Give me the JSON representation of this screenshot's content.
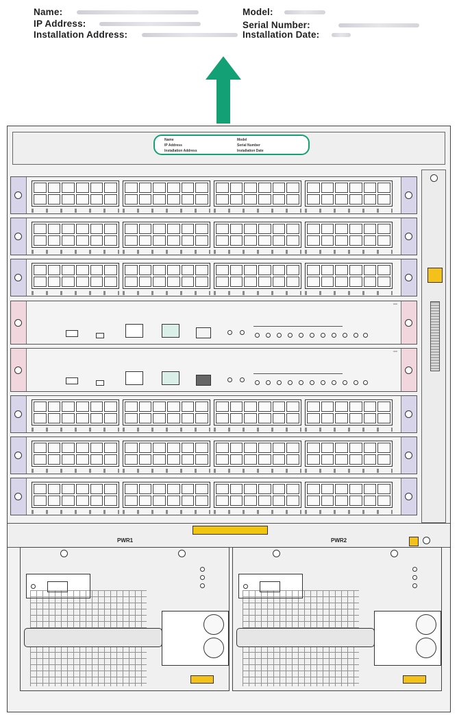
{
  "label": {
    "name": "Name:",
    "ip": "IP Address:",
    "install_addr": "Installation Address:",
    "model": "Model:",
    "serial": "Serial Number:",
    "install_date": "Installation Date:"
  },
  "mini_label": {
    "name": "Name",
    "ip": "IP Address",
    "install_addr": "Installation Address",
    "model": "Model",
    "serial": "Serial Number",
    "install_date": "Installation Date"
  },
  "psu_labels": {
    "pwr1": "PWR1",
    "pwr2": "PWR2"
  },
  "colors": {
    "arrow": "#12a074",
    "ear_blue": "#d8d4ea",
    "ear_pink": "#f1d6de",
    "warning": "#f3c11a"
  },
  "icons": [
    "up-arrow-icon",
    "warning-icon",
    "esd-icon",
    "usb-icon",
    "screw-icon"
  ]
}
